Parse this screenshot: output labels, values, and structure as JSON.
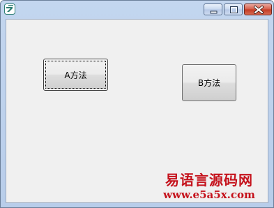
{
  "window": {
    "title": "",
    "icon": "app-icon",
    "controls": {
      "minimize_icon": "minimize-icon",
      "maximize_icon": "maximize-icon",
      "close_icon": "close-icon"
    }
  },
  "buttons": {
    "a_label": "A方法",
    "b_label": "B方法"
  },
  "watermark": {
    "title": "易语言源码网",
    "url": "www.e5a5x.com"
  },
  "colors": {
    "watermark": "#c5121c",
    "client_bg": "#f0f0f0",
    "title_bar": "#c3d6ef",
    "close_button": "#c23a23"
  }
}
